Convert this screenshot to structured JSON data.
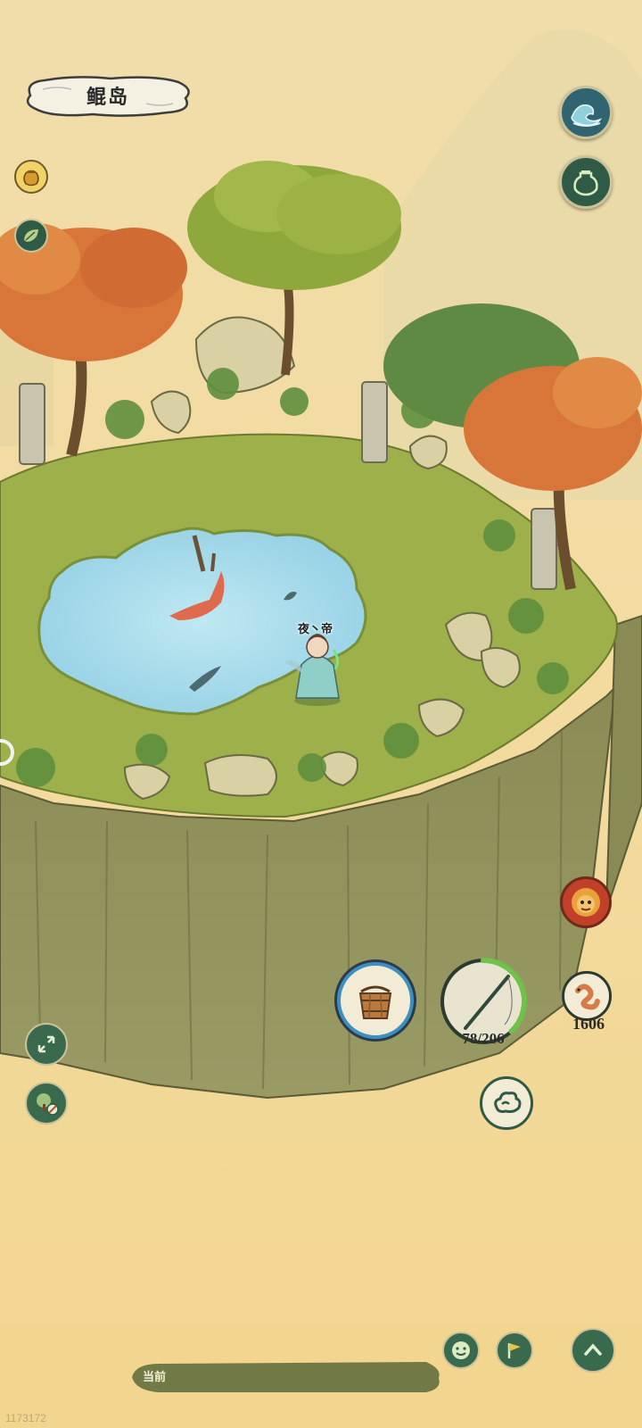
{
  "location": {
    "title": "鲲岛"
  },
  "player": {
    "name": "夜丶帝"
  },
  "rod": {
    "durability_text": "78/206",
    "durability_fraction": 0.38
  },
  "bait": {
    "count": "1606"
  },
  "chat": {
    "label": "当前"
  },
  "watermark": "1173172",
  "icons": {
    "weather": "wave-icon",
    "bag": "jar-icon",
    "honey": "honey-pot-icon",
    "leaf": "leaf-icon",
    "monster": "lion-mask-icon",
    "bucket": "wooden-bucket-icon",
    "rod": "fishing-rod-icon",
    "worm": "worm-bait-icon",
    "cloud": "cloud-icon",
    "expand": "expand-arrows-icon",
    "no-tree": "tree-off-icon",
    "emote": "smiley-icon",
    "flag": "flag-icon",
    "up": "chevron-up-icon"
  },
  "colors": {
    "sky": "#f3dca0",
    "grass": "#9db04a",
    "water": "#a9dcea",
    "cliff": "#8f8f5a",
    "button": "#2f5a46"
  }
}
